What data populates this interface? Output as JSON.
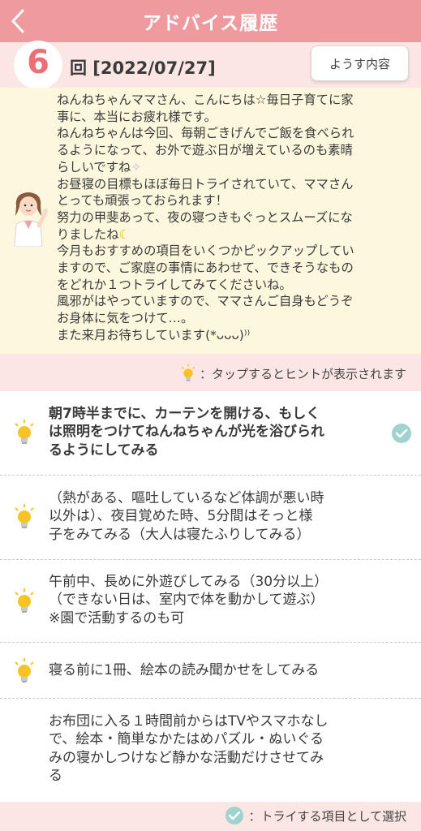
{
  "header": {
    "title": "アドバイス履歴"
  },
  "session": {
    "count": "6",
    "label": "回 [2022/07/27]",
    "detail_button": "ようす内容"
  },
  "advice": {
    "paragraphs": [
      "ねんねちゃんママさん、こんにちは☆毎日子育てに家\n事に、本当にお疲れ様です。",
      "ねんねちゃんは今回、毎朝ごきげんでご飯を食べられ\nるようになって、お外で遊ぶ日が増えているのも素晴\nらしいですね",
      "お昼寝の目標もほぼ毎日トライされていて、ママさん\nとっても頑張っておられます！",
      "努力の甲斐あって、夜の寝つきもぐっとスムーズにな\nりましたね",
      "今月もおすすめの項目をいくつかピックアップしてい\nますので、ご家庭の事情にあわせて、できそうなもの\nをどれか１つトライしてみてくださいね。",
      "風邪がはやっていますので、ママさんご自身もどうぞ\nお身体に気をつけて…。\nまた来月お待ちしています(*ᴗᴗᴗ)⁾⁾"
    ]
  },
  "hint": {
    "text": "：タップするとヒントが表示されます"
  },
  "items": [
    {
      "text": "朝7時半までに、カーテンを開ける、もしく\nは照明をつけてねんねちゃんが光を浴びられ\nるようにしてみる",
      "selected": true
    },
    {
      "text": "（熱がある、嘔吐しているなど体調が悪い時\n以外は）、夜目覚めた時、5分間はそっと様\n子をみてみる（大人は寝たふりしてみる）",
      "selected": false
    },
    {
      "text": "午前中、長めに外遊びしてみる（30分以上）\n（できない日は、室内で体を動かして遊ぶ）\n※園で活動するのも可",
      "selected": false
    },
    {
      "text": "寝る前に1冊、絵本の読み聞かせをしてみる",
      "selected": false
    },
    {
      "text": "お布団に入る１時間前からはTVやスマホなし\nで、絵本・簡単なかたはめパズル・ぬいぐる\nみの寝かしつけなど静かな活動だけさせてみ\nる",
      "selected": false
    }
  ],
  "footer": {
    "text": "：トライする項目として選択"
  },
  "colors": {
    "header": "#ef9a9f",
    "accent_pink": "#ec6f78",
    "advice_bg": "#fdf7dd",
    "check": "#9fd3cd",
    "bulb": "#f7c325"
  }
}
